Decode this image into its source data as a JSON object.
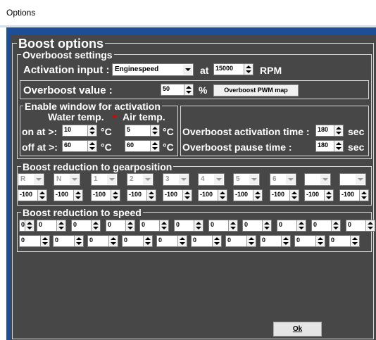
{
  "window": {
    "title": "Options"
  },
  "boost_options": {
    "title": "Boost options"
  },
  "overboost_settings": {
    "title": "Overboost settings",
    "activation_input_label": "Activation input :",
    "activation_input_value": "Enginespeed",
    "at_label": "at",
    "rpm_value": "15000",
    "rpm_unit": "RPM",
    "overboost_value_label": "Overboost value :",
    "overboost_value": "50",
    "percent_unit": "%",
    "pwm_map_button": "Overboost PWM map"
  },
  "enable_window": {
    "title": "Enable window for activation",
    "water_temp_label": "Water temp.",
    "star": "*",
    "air_temp_label": "Air temp.",
    "on_at_label": "on at >:",
    "off_at_label": "off at >:",
    "unit": "°C",
    "on_water": "10",
    "on_air": "5",
    "off_water": "60",
    "off_air": "60"
  },
  "overboost_times": {
    "activation_time_label": "Overboost activation time :",
    "activation_time_value": "180",
    "pause_time_label": "Overboost pause time :",
    "pause_time_value": "180",
    "unit": "sec"
  },
  "gear_reduction": {
    "title": "Boost reduction to gearposition",
    "gears": [
      {
        "label": "R",
        "value": "-100"
      },
      {
        "label": "N",
        "value": "-100"
      },
      {
        "label": "1",
        "value": "-100"
      },
      {
        "label": "2",
        "value": "-100"
      },
      {
        "label": "3",
        "value": "-100"
      },
      {
        "label": "4",
        "value": "-100"
      },
      {
        "label": "5",
        "value": "-100"
      },
      {
        "label": "6",
        "value": "-100"
      },
      {
        "label": "",
        "value": "-100"
      },
      {
        "label": "",
        "value": "-100"
      }
    ]
  },
  "speed_reduction": {
    "title": "Boost reduction to speed",
    "row1": [
      "0",
      "0",
      "0",
      "0",
      "0",
      "0",
      "0",
      "0",
      "0",
      "0",
      "0"
    ],
    "row2": [
      "0",
      "0",
      "0",
      "0",
      "0",
      "0",
      "0",
      "0",
      "0",
      "0"
    ]
  },
  "ok_button": "Ok"
}
